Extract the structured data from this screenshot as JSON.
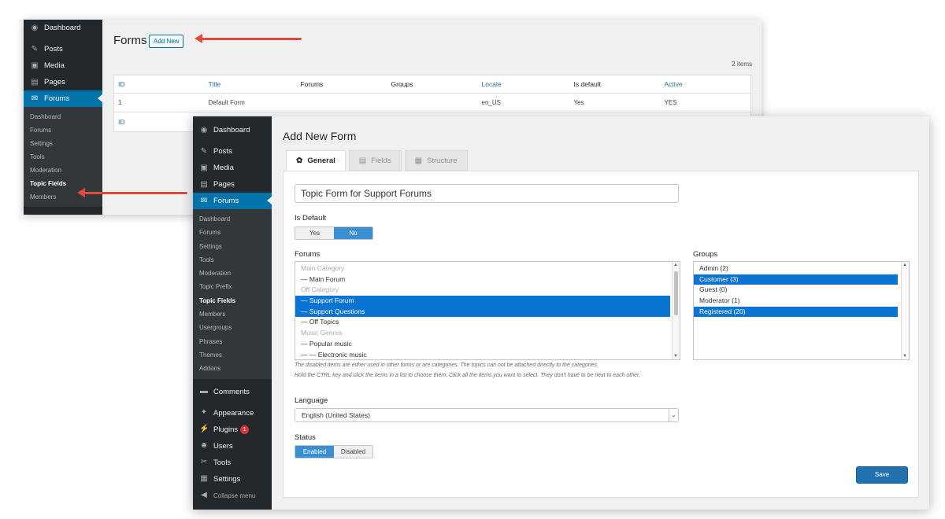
{
  "back": {
    "menu": [
      {
        "label": "Dashboard",
        "icon": "◉"
      },
      {
        "label": "Posts",
        "icon": "✎"
      },
      {
        "label": "Media",
        "icon": "▣"
      },
      {
        "label": "Pages",
        "icon": "▤"
      },
      {
        "label": "Forums",
        "icon": "✉"
      }
    ],
    "submenu": [
      "Dashboard",
      "Forums",
      "Settings",
      "Tools",
      "Moderation",
      "Topic Fields",
      "Members"
    ],
    "page_title": "Forms",
    "add_new": "Add New",
    "item_count": "2 items",
    "columns": [
      "ID",
      "Title",
      "Forums",
      "Groups",
      "Locale",
      "Is default",
      "Active"
    ],
    "row": [
      "1",
      "Default Form",
      "",
      "",
      "en_US",
      "Yes",
      "YES"
    ],
    "footer_id": "ID"
  },
  "front": {
    "menu_top": [
      {
        "label": "Dashboard",
        "icon": "◉"
      },
      {
        "label": "Posts",
        "icon": "✎"
      },
      {
        "label": "Media",
        "icon": "▣"
      },
      {
        "label": "Pages",
        "icon": "▤"
      },
      {
        "label": "Forums",
        "icon": "✉"
      }
    ],
    "submenu": [
      "Dashboard",
      "Forums",
      "Settings",
      "Tools",
      "Moderation",
      "Topic Prefix",
      "Topic Fields",
      "Members",
      "Usergroups",
      "Phrases",
      "Themes",
      "Addons"
    ],
    "menu_bottom": [
      {
        "label": "Comments",
        "icon": "▬"
      },
      {
        "label": "Appearance",
        "icon": "✦"
      },
      {
        "label": "Plugins",
        "icon": "⚡"
      },
      {
        "label": "Users",
        "icon": "☻"
      },
      {
        "label": "Tools",
        "icon": "✂"
      },
      {
        "label": "Settings",
        "icon": "▦"
      },
      {
        "label": "Collapse menu",
        "icon": "◀"
      }
    ],
    "plugins_badge": "1",
    "page_title": "Add New Form",
    "tabs": [
      {
        "label": "General",
        "icon": "✿"
      },
      {
        "label": "Fields",
        "icon": "▤"
      },
      {
        "label": "Structure",
        "icon": "▦"
      }
    ],
    "form_title": "Topic Form for Support Forums",
    "is_default_label": "Is Default",
    "is_default_options": [
      "Yes",
      "No"
    ],
    "forums_label": "Forums",
    "forums_options": [
      {
        "text": "Main Category",
        "state": "dis"
      },
      {
        "text": "— Main Forum",
        "state": ""
      },
      {
        "text": "Off Category",
        "state": "dis"
      },
      {
        "text": "— Support Forum",
        "state": "sel"
      },
      {
        "text": "— Support Questions",
        "state": "sel"
      },
      {
        "text": "— Off Topics",
        "state": ""
      },
      {
        "text": "Music Genres",
        "state": "dis"
      },
      {
        "text": "— Popular music",
        "state": ""
      },
      {
        "text": "— — Electronic music",
        "state": ""
      }
    ],
    "groups_label": "Groups",
    "groups_options": [
      {
        "text": "Admin (2)",
        "state": ""
      },
      {
        "text": "Customer (3)",
        "state": "sel"
      },
      {
        "text": "Guest (0)",
        "state": ""
      },
      {
        "text": "Moderator (1)",
        "state": ""
      },
      {
        "text": "Registered (20)",
        "state": "sel"
      }
    ],
    "help_1": "The disabled items are either used in other forms or are categories. The topics can not be attached directly to the categories.",
    "help_2": "Hold the CTRL key and click the items in a list to choose them. Click all the items you want to select. They don't have to be next to each other.",
    "language_label": "Language",
    "language_value": "English (United States)",
    "status_label": "Status",
    "status_options": [
      "Enabled",
      "Disabled"
    ],
    "save_label": "Save"
  },
  "colors": {
    "accent": "#0073aa",
    "arrow": "#e2493a",
    "selection": "#0a74d2",
    "sidebar": "#23282d"
  }
}
